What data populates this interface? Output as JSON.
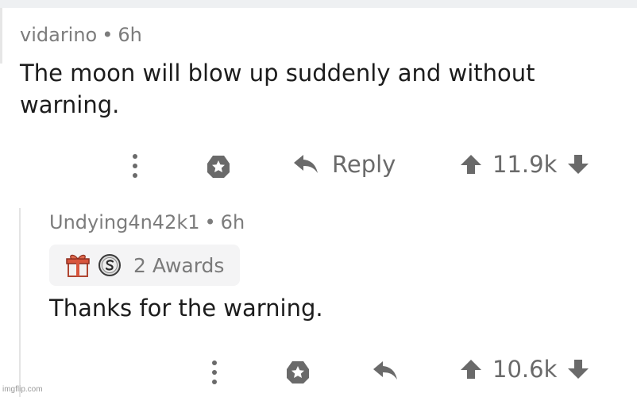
{
  "comments": [
    {
      "username": "vidarino",
      "separator": "•",
      "time": "6h",
      "body": "The moon will blow up suddenly and without warning.",
      "reply_label": "Reply",
      "score": "11.9k"
    },
    {
      "username": "Undying4n42k1",
      "separator": "•",
      "time": "6h",
      "awards_label": "2 Awards",
      "award_icons": [
        "gift-award-icon",
        "silver-award-icon"
      ],
      "body": "Thanks for the warning.",
      "score": "10.6k"
    }
  ],
  "watermark": "imgflip.com",
  "colors": {
    "text": "#1c1c1c",
    "meta": "#7c7c7c",
    "icon": "#6a6a6a",
    "pill_bg": "#f4f4f5",
    "top_bar": "#eef0f2"
  }
}
